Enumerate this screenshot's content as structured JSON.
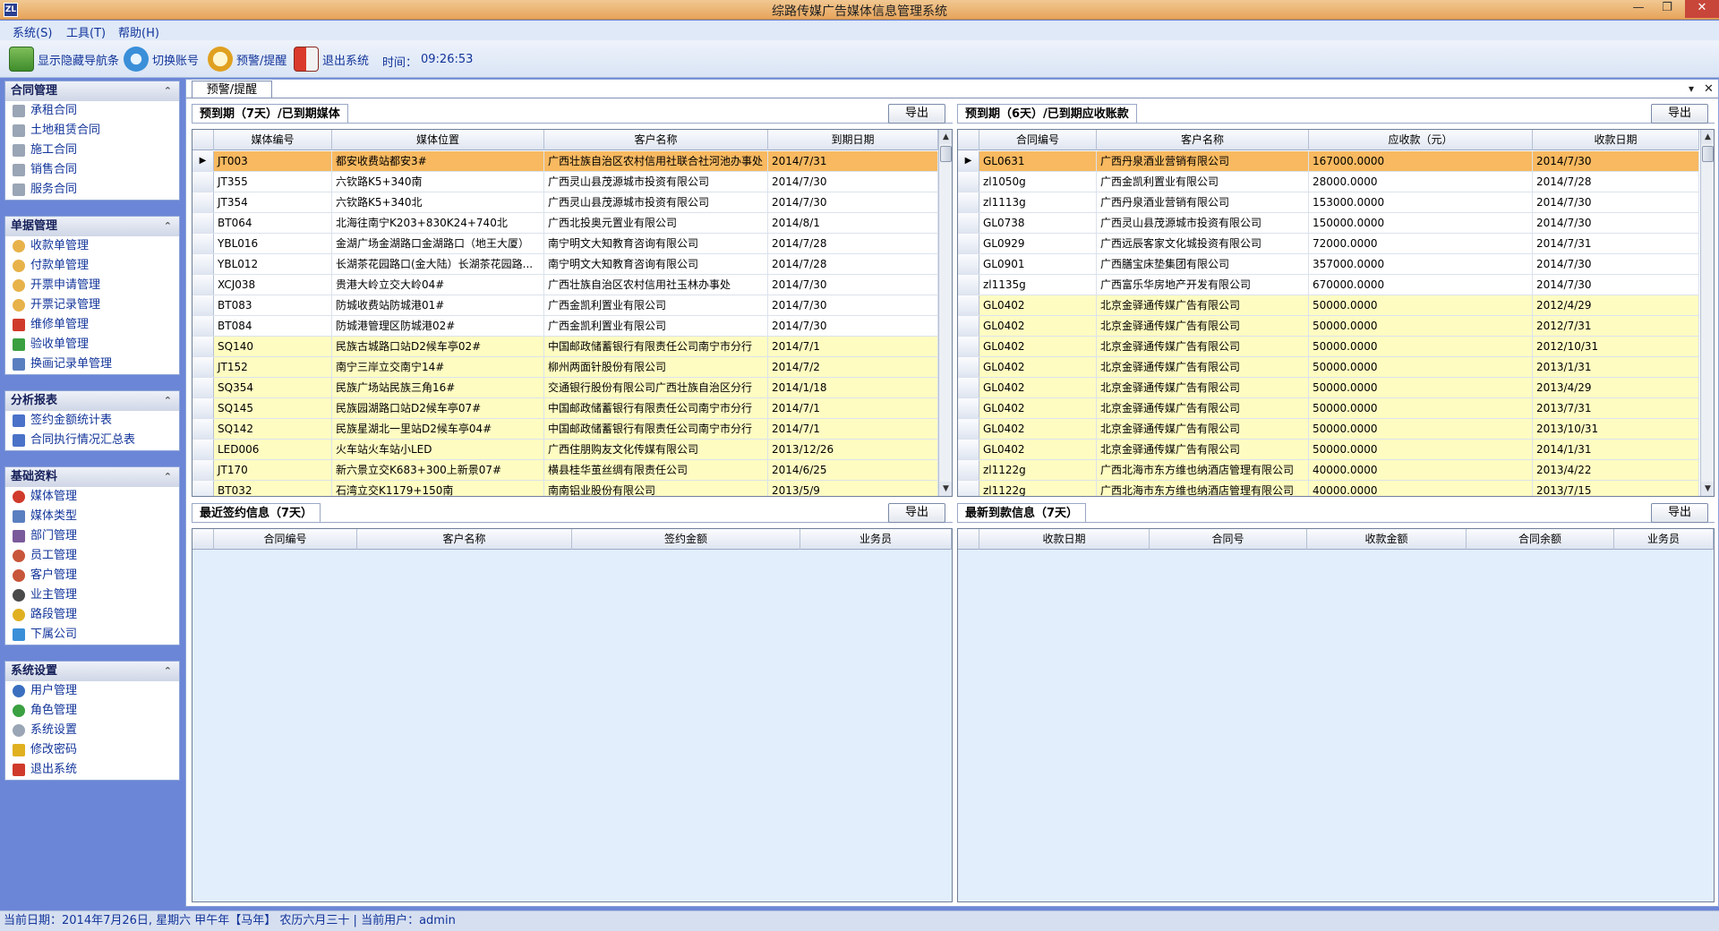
{
  "window": {
    "title": "综路传媒广告媒体信息管理系统",
    "logo_text": "ZL"
  },
  "menu": [
    "系统(S)",
    "工具(T)",
    "帮助(H)"
  ],
  "toolbar": {
    "items": [
      "显示隐藏导航条",
      "切换账号",
      "预警/提醒",
      "退出系统"
    ],
    "time_label": "时间：",
    "time_value": "09:26:53"
  },
  "sidebar": [
    {
      "title": "合同管理",
      "items": [
        "承租合同",
        "土地租赁合同",
        "施工合同",
        "销售合同",
        "服务合同"
      ]
    },
    {
      "title": "单据管理",
      "items": [
        "收款单管理",
        "付款单管理",
        "开票申请管理",
        "开票记录管理",
        "维修单管理",
        "验收单管理",
        "换画记录单管理"
      ]
    },
    {
      "title": "分析报表",
      "items": [
        "签约金额统计表",
        "合同执行情况汇总表"
      ]
    },
    {
      "title": "基础资料",
      "items": [
        "媒体管理",
        "媒体类型",
        "部门管理",
        "员工管理",
        "客户管理",
        "业主管理",
        "路段管理",
        "下属公司"
      ]
    },
    {
      "title": "系统设置",
      "items": [
        "用户管理",
        "角色管理",
        "系统设置",
        "修改密码",
        "退出系统"
      ]
    }
  ],
  "doc_tab": "预警/提醒",
  "export_label": "导出",
  "expiring_media": {
    "title": "预到期（7天）/已到期媒体",
    "columns": [
      "媒体编号",
      "媒体位置",
      "客户名称",
      "到期日期"
    ],
    "rows": [
      [
        "JT003",
        "都安收费站都安3#",
        "广西壮族自治区农村信用社联合社河池办事处",
        "2014/7/31"
      ],
      [
        "JT355",
        "六钦路K5+340南",
        "广西灵山县茂源城市投资有限公司",
        "2014/7/30"
      ],
      [
        "JT354",
        "六钦路K5+340北",
        "广西灵山县茂源城市投资有限公司",
        "2014/7/30"
      ],
      [
        "BT064",
        "北海往南宁K203+830K24+740北",
        "广西北投奥元置业有限公司",
        "2014/8/1"
      ],
      [
        "YBL016",
        "金湖广场金湖路口金湖路口（地王大厦）",
        "南宁明文大知教育咨询有限公司",
        "2014/7/28"
      ],
      [
        "YBL012",
        "长湖茶花园路口(金大陆）长湖茶花园路...",
        "南宁明文大知教育咨询有限公司",
        "2014/7/28"
      ],
      [
        "XCJ038",
        "贵港大岭立交大岭04#",
        "广西壮族自治区农村信用社玉林办事处",
        "2014/7/30"
      ],
      [
        "BT083",
        "防城收费站防城港01#",
        "广西金凯利置业有限公司",
        "2014/7/30"
      ],
      [
        "BT084",
        "防城港管理区防城港02#",
        "广西金凯利置业有限公司",
        "2014/7/30"
      ],
      [
        "SQ140",
        "民族古城路口站D2候车亭02#",
        "中国邮政储蓄银行有限责任公司南宁市分行",
        "2014/7/1"
      ],
      [
        "JT152",
        "南宁三岸立交南宁14#",
        "柳州两面针股份有限公司",
        "2014/7/2"
      ],
      [
        "SQ354",
        "民族广场站民族三角16#",
        "交通银行股份有限公司广西壮族自治区分行",
        "2014/1/18"
      ],
      [
        "SQ145",
        "民族园湖路口站D2候车亭07#",
        "中国邮政储蓄银行有限责任公司南宁市分行",
        "2014/7/1"
      ],
      [
        "SQ142",
        "民族星湖北一里站D2候车亭04#",
        "中国邮政储蓄银行有限责任公司南宁市分行",
        "2014/7/1"
      ],
      [
        "LED006",
        "火车站火车站小LED",
        "广西住朋购友文化传媒有限公司",
        "2013/12/26"
      ],
      [
        "JT170",
        "新六景立交K683+300上新景07#",
        "横县桂华茧丝绸有限责任公司",
        "2014/6/25"
      ],
      [
        "BT032",
        "石湾立交K1179+150南",
        "南南铝业股份有限公司",
        "2013/5/9"
      ]
    ]
  },
  "receivables": {
    "title": "预到期（6天）/已到期应收账款",
    "columns": [
      "合同编号",
      "客户名称",
      "应收款（元）",
      "收款日期"
    ],
    "rows": [
      [
        "GL0631",
        "广西丹泉酒业营销有限公司",
        "167000.0000",
        "2014/7/30"
      ],
      [
        "zl1050g",
        "广西金凯利置业有限公司",
        "28000.0000",
        "2014/7/28"
      ],
      [
        "zl1113g",
        "广西丹泉酒业营销有限公司",
        "153000.0000",
        "2014/7/30"
      ],
      [
        "GL0738",
        "广西灵山县茂源城市投资有限公司",
        "150000.0000",
        "2014/7/30"
      ],
      [
        "GL0929",
        "广西远辰客家文化城投资有限公司",
        "72000.0000",
        "2014/7/31"
      ],
      [
        "GL0901",
        "广西膳宝床垫集团有限公司",
        "357000.0000",
        "2014/7/30"
      ],
      [
        "zl1135g",
        "广西富乐华房地产开发有限公司",
        "670000.0000",
        "2014/7/30"
      ],
      [
        "GL0402",
        "北京金驿通传媒广告有限公司",
        "50000.0000",
        "2012/4/29"
      ],
      [
        "GL0402",
        "北京金驿通传媒广告有限公司",
        "50000.0000",
        "2012/7/31"
      ],
      [
        "GL0402",
        "北京金驿通传媒广告有限公司",
        "50000.0000",
        "2012/10/31"
      ],
      [
        "GL0402",
        "北京金驿通传媒广告有限公司",
        "50000.0000",
        "2013/1/31"
      ],
      [
        "GL0402",
        "北京金驿通传媒广告有限公司",
        "50000.0000",
        "2013/4/29"
      ],
      [
        "GL0402",
        "北京金驿通传媒广告有限公司",
        "50000.0000",
        "2013/7/31"
      ],
      [
        "GL0402",
        "北京金驿通传媒广告有限公司",
        "50000.0000",
        "2013/10/31"
      ],
      [
        "GL0402",
        "北京金驿通传媒广告有限公司",
        "50000.0000",
        "2014/1/31"
      ],
      [
        "zl1122g",
        "广西北海市东方维也纳酒店管理有限公司",
        "40000.0000",
        "2013/4/22"
      ],
      [
        "zl1122g",
        "广西北海市东方维也纳酒店管理有限公司",
        "40000.0000",
        "2013/7/15"
      ]
    ]
  },
  "recent_contracts": {
    "title": "最近签约信息（7天）",
    "columns": [
      "合同编号",
      "客户名称",
      "签约金额",
      "业务员"
    ]
  },
  "recent_payments": {
    "title": "最新到款信息（7天）",
    "columns": [
      "收款日期",
      "合同号",
      "收款金额",
      "合同余额",
      "业务员"
    ]
  },
  "status": "当前日期：2014年7月26日, 星期六 甲午年【马年】 农历六月三十 | 当前用户：admin",
  "colors": {
    "selected_row": "#f8b960",
    "warning_row": "#fffcc2",
    "sidebar_bg": "#6b86d6"
  }
}
